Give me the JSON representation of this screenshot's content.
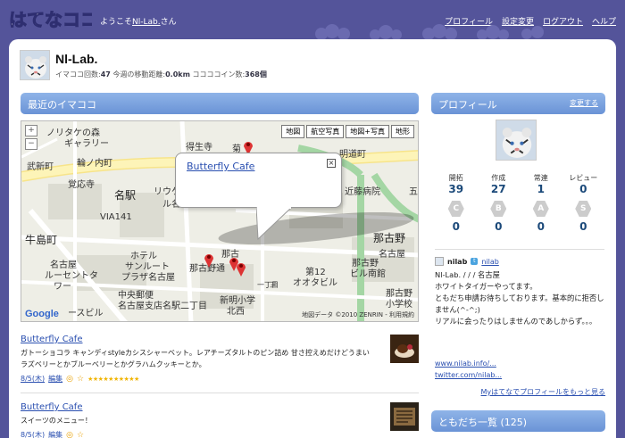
{
  "header": {
    "logo_text": "はてなココ",
    "welcome_prefix": "ようこそ",
    "welcome_user": "Nl-Lab.",
    "welcome_suffix": "さん",
    "nav": [
      "プロフィール",
      "設定変更",
      "ログアウト",
      "ヘルプ"
    ]
  },
  "profile_header": {
    "name": "Nl-Lab.",
    "imacoco_count_label": "イマココ回数:",
    "imacoco_count": "47",
    "distance_label": "今週の移動距離:",
    "distance": "0.0km",
    "coin_label": "ココココイン数:",
    "coins": "368個"
  },
  "recent_section": {
    "title": "最近のイマココ"
  },
  "map": {
    "type_buttons": [
      "地図",
      "航空写真",
      "地図+写真",
      "地形"
    ],
    "zoom_in": "+",
    "zoom_out": "−",
    "info_title": "Butterfly Cafe",
    "close": "×",
    "labels": {
      "l1": "ノリタケの森",
      "l2": "ギャラリー",
      "l3": "武新町",
      "l4": "輪ノ内町",
      "l5": "覚応寺",
      "l6": "名駅",
      "l7": "リウケ",
      "l8": "ル名",
      "l9": "VIA141",
      "l10": "牛島町",
      "l11": "ホテル",
      "l12": "サンルート",
      "l13": "プラザ名古屋",
      "l14": "名古屋",
      "l15": "ルーセントタ",
      "l16": "ワー",
      "l17": "中央郵便",
      "l18": "名古屋支店",
      "l19": "ースビル",
      "l20": "得生寺",
      "l21": "菊",
      "l22": "明道町",
      "l23": "近藤病院",
      "l24": "那古野",
      "l25": "名古屋",
      "l26": "那古野通",
      "l27": "那古野",
      "l28": "ビル南館",
      "l29": "第12",
      "l30": "オオタビル",
      "l31": "名駅二丁目",
      "l32": "新明小学",
      "l33": "北西",
      "l34": "那古野",
      "l35": "小学校",
      "l36": "五",
      "l37": "三",
      "l38": "那古",
      "l39": "一丁目"
    },
    "google": "Google",
    "copyright": "地図データ ©2010 ZENRIN - 利用規約"
  },
  "entries": [
    {
      "title": "Butterfly Cafe",
      "body": "ガトーショコラ キャンディstyleカシスシャーベット。レアチーズタルトのピン詰め 甘さ控えめだけどうまい ラズベリーとかブルーベリーとかグラハムクッキーとか。",
      "date": "8/5(木)",
      "edit": "編集",
      "stars": "★★★★★★★★★★"
    },
    {
      "title": "Butterfly Cafe",
      "body": "スイーツのメニュー！",
      "date": "8/5(木)",
      "edit": "編集",
      "stars": ""
    }
  ],
  "right_profile": {
    "title": "プロフィール",
    "edit": "変更する",
    "stats": [
      {
        "label": "開拓",
        "value": "39"
      },
      {
        "label": "作成",
        "value": "27"
      },
      {
        "label": "常連",
        "value": "1"
      },
      {
        "label": "レビュー",
        "value": "0"
      }
    ],
    "badges": [
      {
        "letter": "C",
        "value": "0"
      },
      {
        "letter": "B",
        "value": "0"
      },
      {
        "letter": "A",
        "value": "0"
      },
      {
        "letter": "S",
        "value": "0"
      }
    ],
    "id": "nilab",
    "twitter": "nilab",
    "desc_line1": "Nl-Lab. / / / 名古屋",
    "desc_line2": "ホワイトタイガーやってます。",
    "desc_line3": "ともだち申請お待ちしております。基本的に拒否しません(^-^;)",
    "desc_line4": "リアルに会ったりはしませんのであしからず。。。",
    "link1": "www.nilab.info/...",
    "link2": "twitter.com/nilab...",
    "more": "Myはてなでプロフィールをもっと見る"
  },
  "friends": {
    "title": "ともだち一覧 (125)"
  },
  "colors": {
    "background": "#54549a",
    "section_bar": "#7aa0dc",
    "link": "#2a4fb0"
  }
}
